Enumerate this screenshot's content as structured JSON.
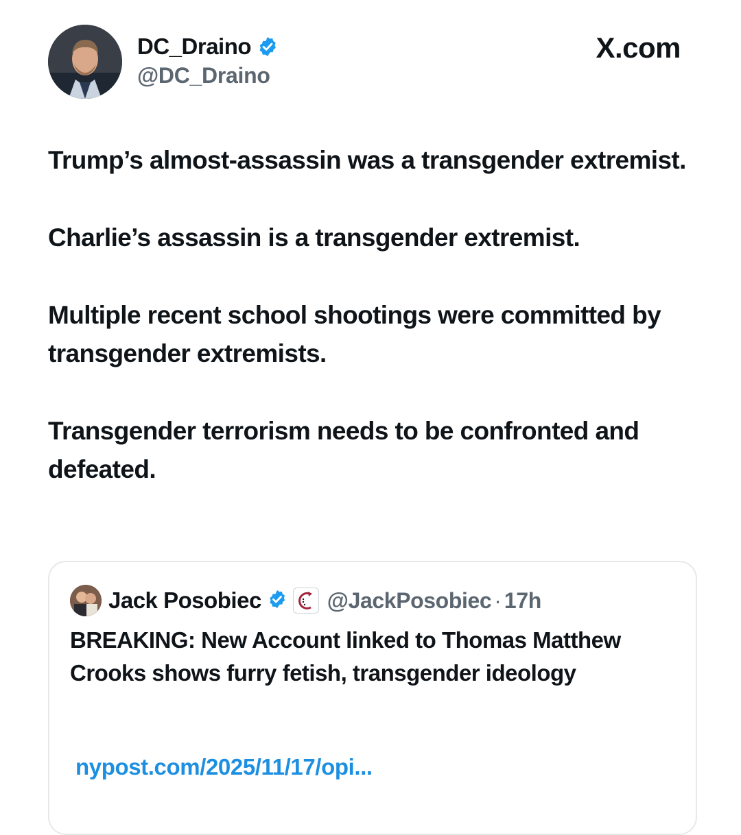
{
  "author": {
    "display_name": "DC_Draino",
    "handle": "@DC_Draino",
    "verified": true,
    "avatar_icon": "profile-photo"
  },
  "site_mark": "X.com",
  "tweet": {
    "paragraphs": [
      "Trump’s almost-assassin was a transgender extremist.",
      "Charlie’s assassin is a transgender extremist.",
      "Multiple recent school shootings were committed by transgender extremists.",
      "Transgender terrorism needs to be confronted and defeated."
    ]
  },
  "quoted": {
    "display_name": "Jack Posobiec",
    "handle": "@JackPosobiec",
    "separator": "·",
    "time": "17h",
    "verified": true,
    "affiliation_icon": "affiliate-badge-icon",
    "text": "BREAKING: New Account linked to Thomas Matthew Crooks shows furry fetish, transgender ideology",
    "link": "nypost.com/2025/11/17/opi..."
  },
  "colors": {
    "text": "#0f1419",
    "muted": "#5b6670",
    "verified_blue": "#1d9bf0",
    "link_blue": "#1d8fe0",
    "card_border": "#e6e9ec"
  }
}
